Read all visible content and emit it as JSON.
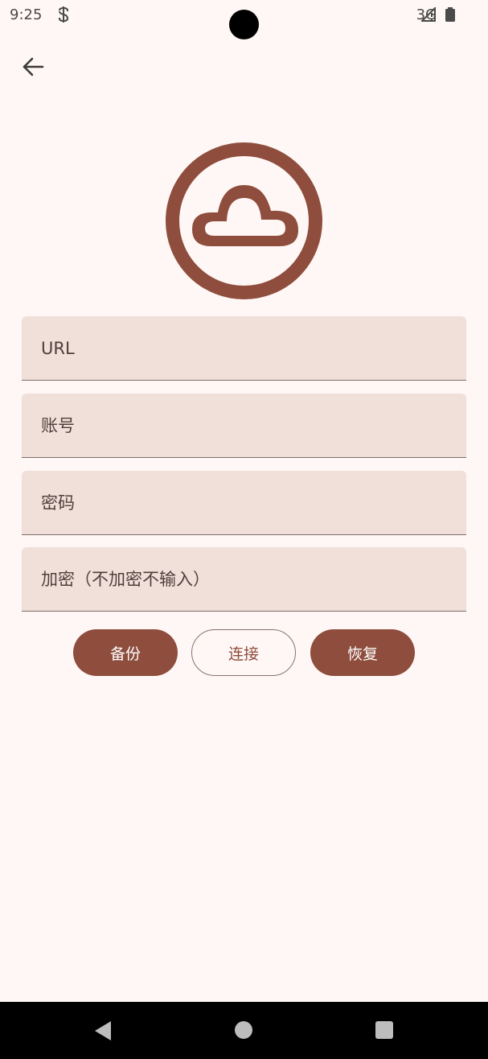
{
  "status_bar": {
    "time": "9:25",
    "network": "3G",
    "icons": [
      "app-notification-icon",
      "signal-icon",
      "battery-icon"
    ]
  },
  "header": {
    "back_icon": "arrow-back-icon"
  },
  "logo": {
    "icon": "cloud-icon",
    "color": "#8e4d3d"
  },
  "form": {
    "url_placeholder": "URL",
    "account_placeholder": "账号",
    "password_placeholder": "密码",
    "encrypt_placeholder": "加密（不加密不输入）"
  },
  "actions": {
    "backup_label": "备份",
    "connect_label": "连接",
    "restore_label": "恢复"
  },
  "navigation": {
    "icons": [
      "nav-back-icon",
      "nav-home-icon",
      "nav-recents-icon"
    ]
  },
  "colors": {
    "background": "#fff7f5",
    "primary": "#8e4d3d",
    "field_background": "#f1e0da"
  }
}
